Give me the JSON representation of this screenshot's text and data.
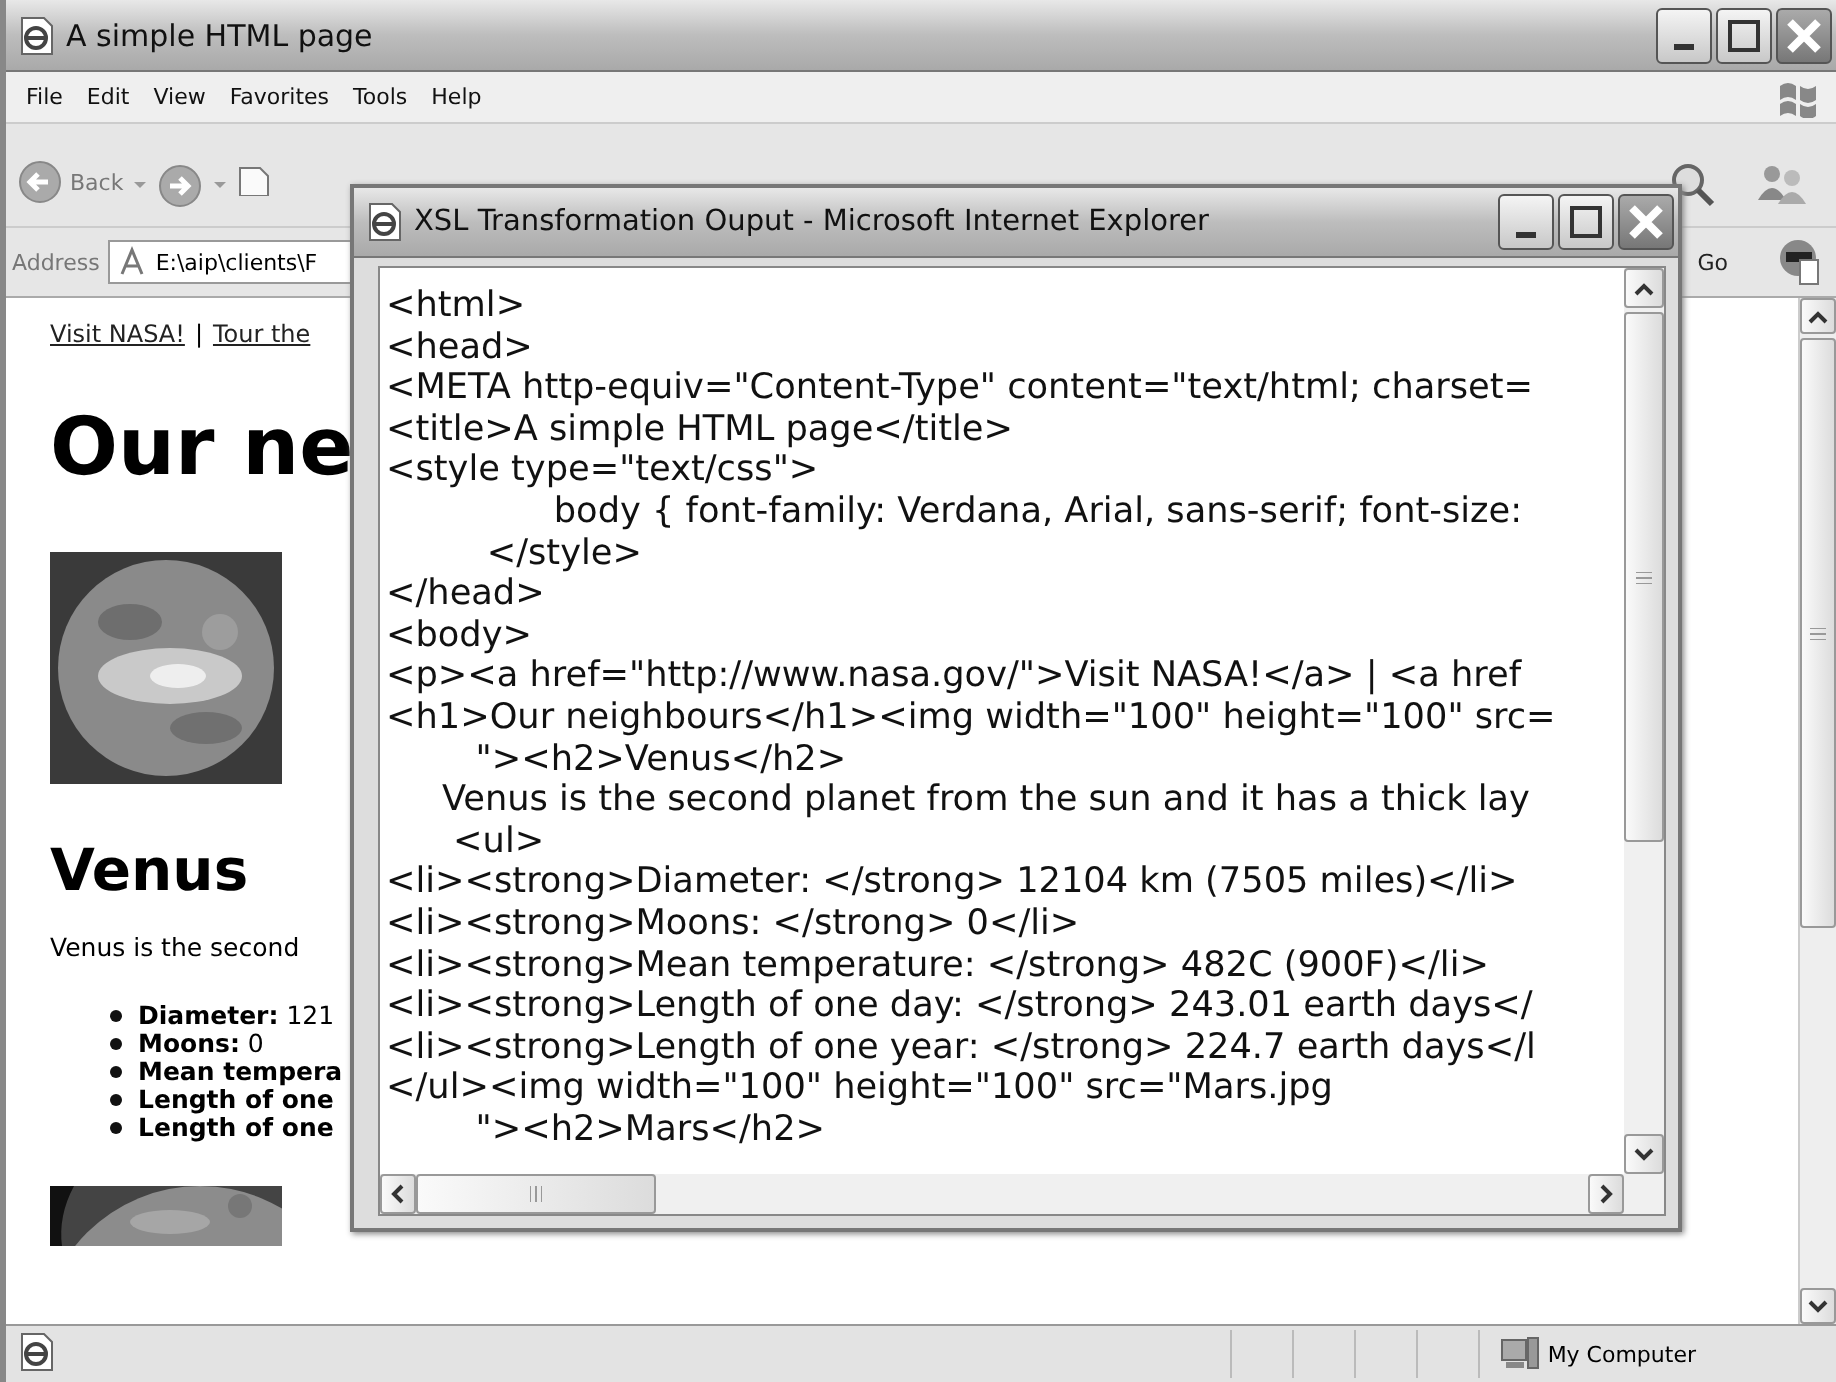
{
  "window": {
    "title": "A simple HTML page"
  },
  "menu": [
    "File",
    "Edit",
    "View",
    "Favorites",
    "Tools",
    "Help"
  ],
  "toolbar": {
    "back_label": "Back"
  },
  "address_bar": {
    "label": "Address",
    "value": "E:\\aip\\clients\\F",
    "go_label": "Go"
  },
  "page": {
    "links": [
      "Visit NASA!",
      "Tour the"
    ],
    "separator": "|",
    "heading": "Our ne",
    "planet_heading": "Venus",
    "intro": "Venus is the second",
    "facts": [
      "**Diameter:** 121",
      "**Moons:** 0",
      "**Mean tempera**",
      "**Length of one**",
      "**Length of one**"
    ]
  },
  "status_bar": {
    "zone": "My Computer"
  },
  "popup": {
    "title": "XSL Transformation Ouput - Microsoft Internet Explorer",
    "lines": [
      "<html>",
      "<head>",
      "<META http-equiv=\"Content-Type\" content=\"text/html; charset=",
      "<title>A simple HTML page</title>",
      "<style type=\"text/css\">",
      "               body { font-family: Verdana, Arial, sans-serif; font-size: ",
      "         </style>",
      "</head>",
      "<body>",
      "<p><a href=\"http://www.nasa.gov/\">Visit NASA!</a> | <a href",
      "<h1>Our neighbours</h1><img width=\"100\" height=\"100\" src=",
      "        \"><h2>Venus</h2>",
      "     Venus is the second planet from the sun and it has a thick lay",
      "      <ul>",
      "<li><strong>Diameter: </strong> 12104 km (7505 miles)</li>",
      "<li><strong>Moons: </strong> 0</li>",
      "<li><strong>Mean temperature: </strong> 482C (900F)</li>",
      "<li><strong>Length of one day: </strong> 243.01 earth days</",
      "<li><strong>Length of one year: </strong> 224.7 earth days</l",
      "</ul><img width=\"100\" height=\"100\" src=\"Mars.jpg",
      "        \"><h2>Mars</h2>"
    ]
  }
}
